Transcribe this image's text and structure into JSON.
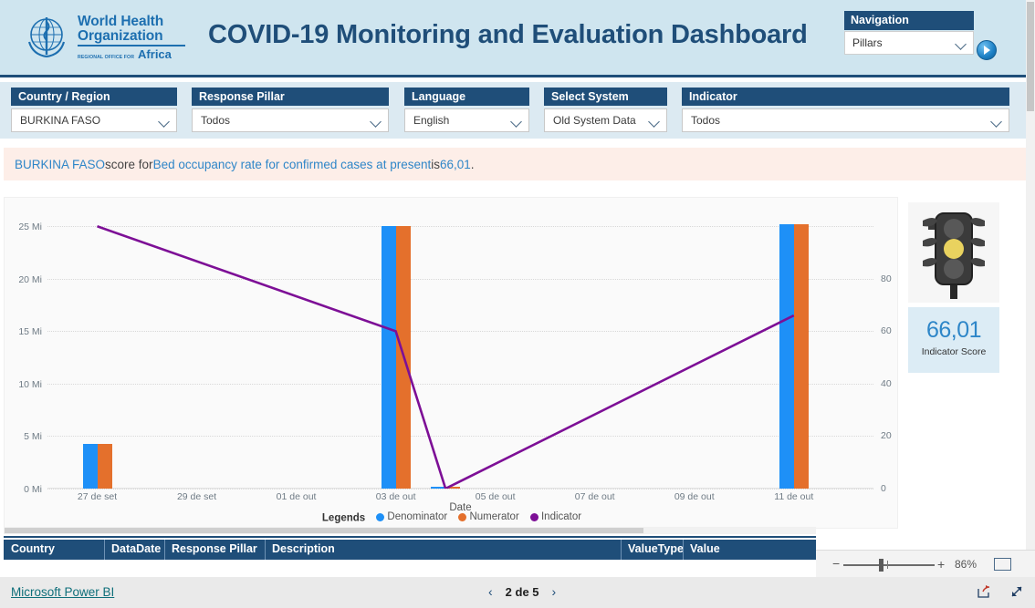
{
  "header": {
    "logo": {
      "line1": "World Health",
      "line2": "Organization",
      "region_prefix": "REGIONAL OFFICE FOR",
      "region": "Africa"
    },
    "title": "COVID-19 Monitoring and Evaluation  Dashboard",
    "navigation": {
      "label": "Navigation",
      "value": "Pillars",
      "go_icon": "arrow-right-circle-icon"
    }
  },
  "filters": [
    {
      "label": "Country / Region",
      "value": "BURKINA FASO"
    },
    {
      "label": "Response Pillar",
      "value": "Todos"
    },
    {
      "label": "Language",
      "value": "English"
    },
    {
      "label": "Select System",
      "value": "Old System Data"
    },
    {
      "label": "Indicator",
      "value": "Todos"
    }
  ],
  "message": {
    "country": "BURKINA FASO",
    "mid": " score for ",
    "indicator": "Bed occupancy rate for confirmed cases at present",
    "tail": " is ",
    "score": "66,01",
    "period": "."
  },
  "chart_data": {
    "type": "bar",
    "title": "",
    "xlabel": "Date",
    "ylabel": "",
    "categories": [
      "27 de set",
      "29 de set",
      "01 de out",
      "03 de out",
      "05 de out",
      "07 de out",
      "09 de out",
      "11 de out"
    ],
    "x_tick_labels": [
      "27 de set",
      "29 de set",
      "01 de out",
      "03 de out",
      "05 de out",
      "07 de out",
      "09 de out",
      "11 de out"
    ],
    "y_left_ticks": [
      "0 Mi",
      "5 Mi",
      "10 Mi",
      "15 Mi",
      "20 Mi",
      "25 Mi"
    ],
    "y_left_values": [
      0,
      5,
      10,
      15,
      20,
      25
    ],
    "ylim_left": [
      0,
      26.5
    ],
    "y_right_ticks": [
      "0",
      "20",
      "40",
      "60",
      "80"
    ],
    "y_right_values": [
      0,
      20,
      40,
      60,
      80
    ],
    "ylim_right": [
      0,
      106
    ],
    "grid": true,
    "legend_title": "Legends",
    "legend_position": "bottom",
    "series": [
      {
        "name": "Denominator",
        "color": "#1e90f7",
        "type": "bar",
        "points": [
          {
            "x": "27 de set",
            "y": 4.3
          },
          {
            "x": "03 de out",
            "y": 25.0
          },
          {
            "x": "04 de out",
            "y": 0.08
          },
          {
            "x": "11 de out",
            "y": 25.2
          }
        ]
      },
      {
        "name": "Numerator",
        "color": "#e4702c",
        "type": "bar",
        "points": [
          {
            "x": "27 de set",
            "y": 4.3
          },
          {
            "x": "03 de out",
            "y": 25.0
          },
          {
            "x": "04 de out",
            "y": 0.06
          },
          {
            "x": "11 de out",
            "y": 25.2
          }
        ]
      },
      {
        "name": "Indicator",
        "color": "#7d0f96",
        "type": "line",
        "points": [
          {
            "x": "27 de set",
            "y": 100
          },
          {
            "x": "03 de out",
            "y": 60
          },
          {
            "x": "04 de out",
            "y": 0
          },
          {
            "x": "11 de out",
            "y": 66.01
          }
        ]
      }
    ]
  },
  "indicator_panel": {
    "traffic_light": {
      "icon": "traffic-light-icon",
      "active": "yellow",
      "colors": {
        "red": "#585858",
        "yellow": "#e9d25f",
        "green": "#585858"
      }
    },
    "score_value": "66,01",
    "score_label": "Indicator Score",
    "score_color": "#2e86c8"
  },
  "table": {
    "columns": [
      "Country",
      "DataDate",
      "Response Pillar",
      "Description",
      "ValueType",
      "Value"
    ],
    "rows": []
  },
  "statusbar": {
    "minus": "−",
    "plus": "+",
    "zoom_percent": "86%",
    "fit_icon": "fit-to-page-icon"
  },
  "footer": {
    "powerbi_link": "Microsoft Power BI",
    "prev_icon": "chevron-left-icon",
    "next_icon": "chevron-right-icon",
    "page_text": "2 de 5",
    "share_icon": "share-icon",
    "fullscreen_icon": "expand-arrows-icon"
  }
}
